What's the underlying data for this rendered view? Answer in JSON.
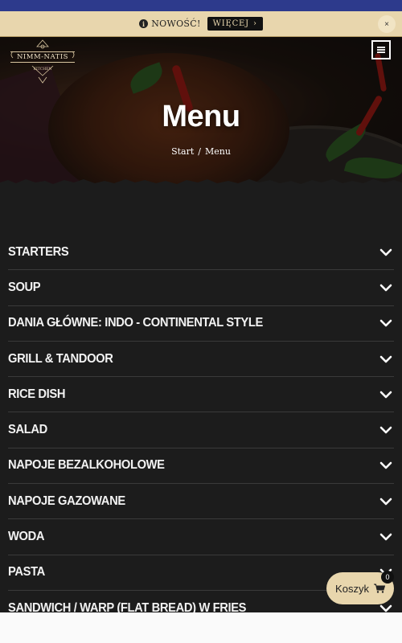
{
  "announcement": {
    "text": "NOWOŚĆ!",
    "button_label": "WIĘCEJ",
    "button_arrow": "›",
    "close_label": "×",
    "info_icon": "i"
  },
  "header": {
    "logo_name": "NIMM-NATIS",
    "logo_sub": "KITCHEN"
  },
  "hero": {
    "title": "Menu",
    "breadcrumb": {
      "home": "Start",
      "separator": "/",
      "current": "Menu"
    }
  },
  "menu_categories": [
    "STARTERS",
    "SOUP",
    "DANIA GŁÓWNE: INDO - CONTINENTAL STYLE",
    "GRILL & TANDOOR",
    "RICE DISH",
    "SALAD",
    "NAPOJE BEZALKOHOLOWE",
    "NAPOJE GAZOWANE",
    "WODA",
    "PASTA",
    "SANDWICH / WARP (FLAT BREAD) W FRIES"
  ],
  "cart": {
    "label": "Koszyk",
    "count": "0"
  },
  "colors": {
    "status_bar": "#2d3a8c",
    "announcement_bg": "#e8d6ad",
    "page_bg": "#1c1c1c",
    "text": "#f2f2f2",
    "divider": "#3a3a3a",
    "accent": "#e8d6ad"
  }
}
